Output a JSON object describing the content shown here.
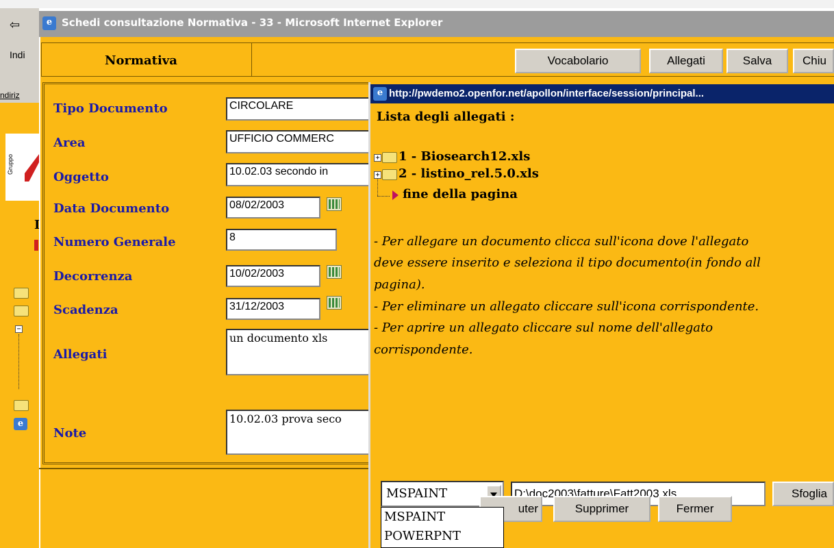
{
  "background": {
    "ind_label": "Indi",
    "indirizzo_label": "ndiriz",
    "gruppo_label": "Gruppo"
  },
  "window": {
    "title": "Schedi consultazione Normativa - 33 - Microsoft Internet Explorer"
  },
  "header": {
    "section_title": "Normativa"
  },
  "toolbar": {
    "vocabolario": "Vocabolario",
    "allegati": "Allegati",
    "salva": "Salva",
    "chiudi": "Chiu"
  },
  "form": {
    "tipo_documento": {
      "label": "Tipo Documento",
      "value": "CIRCOLARE"
    },
    "area": {
      "label": "Area",
      "value": "UFFICIO COMMERC"
    },
    "oggetto": {
      "label": "Oggetto",
      "value": "10.02.03 secondo in"
    },
    "data_documento": {
      "label": "Data Documento",
      "value": "08/02/2003"
    },
    "numero_generale": {
      "label": "Numero Generale",
      "value": "8"
    },
    "decorrenza": {
      "label": "Decorrenza",
      "value": "10/02/2003"
    },
    "scadenza": {
      "label": "Scadenza",
      "value": "31/12/2003"
    },
    "allegati": {
      "label": "Allegati",
      "value": "un documento xls"
    },
    "note": {
      "label": "Note",
      "value": "10.02.03 prova seco"
    }
  },
  "popup": {
    "title": "http://pwdemo2.openfor.net/apollon/interface/session/principal...",
    "list_title": "Lista degli allegati :",
    "items": [
      {
        "label": "1 - Biosearch12.xls"
      },
      {
        "label": "2 - listino_rel.5.0.xls"
      }
    ],
    "end_label": "fine della pagina",
    "instructions": [
      "- Per allegare un documento clicca sull'icona dove l'allegato",
      "deve essere inserito e seleziona il tipo documento(in fondo all",
      "pagina).",
      "- Per eliminare un allegato cliccare sull'icona corrispondente.",
      "- Per aprire un allegato cliccare sul nome dell'allegato",
      "corrispondente."
    ],
    "doc_type_selected": "MSPAINT",
    "doc_type_options": [
      "MSPAINT",
      "POWERPNT"
    ],
    "file_path": "D:\\doc2003\\fatture\\Fatt2003.xls",
    "browse_button": "Sfoglia",
    "ajouter_button": "uter",
    "supprimer_button": "Supprimer",
    "fermer_button": "Fermer"
  },
  "colors": {
    "background_orange": "#fbb914",
    "label_blue": "#1a1aa8",
    "popup_titlebar": "#0a246a",
    "inactive_titlebar": "#9c9c9c"
  }
}
